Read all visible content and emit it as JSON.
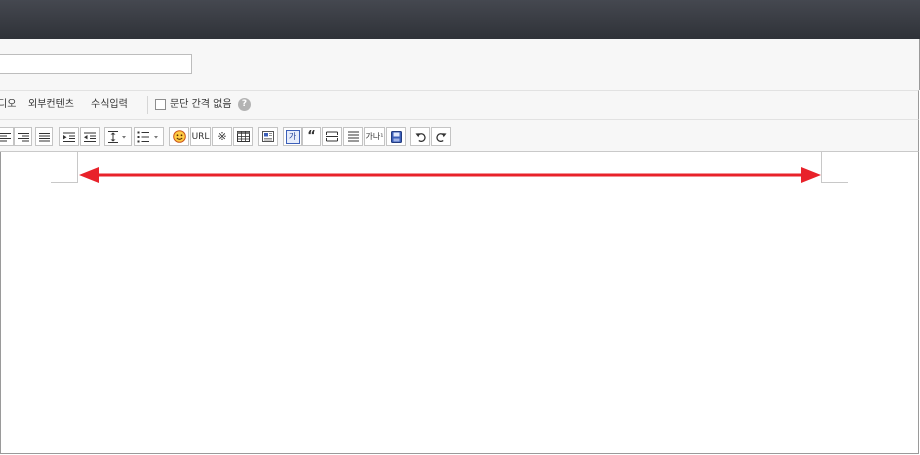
{
  "title_input": {
    "value": "",
    "placeholder": ""
  },
  "menubar": {
    "items": [
      {
        "label": "디오"
      },
      {
        "label": "외부컨텐츠"
      },
      {
        "label": "수식입력"
      }
    ],
    "paragraph_spacing_checkbox": {
      "label": "문단 간격 없음",
      "checked": false
    },
    "help_glyph": "?"
  },
  "toolbar": {
    "url_label": "URL",
    "special_char_glyph": "※",
    "quote_glyph": "“",
    "hanja_glyph": "가",
    "superscript_label": "가나¹",
    "icons": [
      "align-left-icon",
      "align-right-icon",
      "align-justify-icon",
      "indent-icon",
      "outdent-icon",
      "line-height-icon",
      "list-icon",
      "emoticon-icon",
      "url-icon",
      "special-char-icon",
      "table-icon",
      "template-icon",
      "hanja-icon",
      "quote-icon",
      "horizontal-line-icon",
      "paragraph-spacing-icon",
      "superscript-icon",
      "save-icon",
      "undo-icon",
      "redo-icon"
    ]
  },
  "colors": {
    "topbar": "#3a3d43",
    "panel": "#f7f7f7",
    "arrow": "#e8222a",
    "accent_blue": "#3b5eb8"
  }
}
